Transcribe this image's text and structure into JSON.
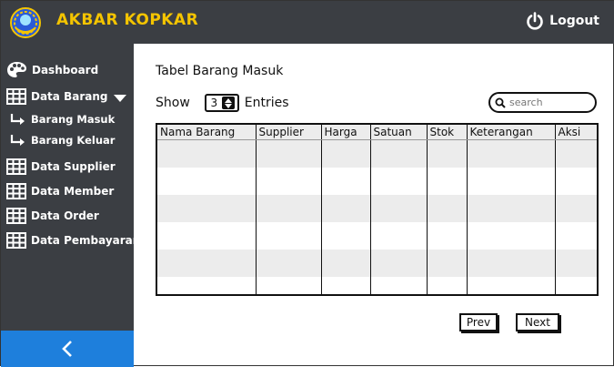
{
  "header": {
    "brand": "AKBAR KOPKAR",
    "logout_label": "Logout",
    "colors": {
      "background": "#3b3e43",
      "brand": "#f4c400"
    }
  },
  "sidebar": {
    "items": [
      {
        "label": "Dashboard",
        "icon": "palette-icon"
      },
      {
        "label": "Data Barang",
        "icon": "table-icon",
        "expanded": true
      },
      {
        "label": "Barang Masuk",
        "icon": "sub-arrow-icon"
      },
      {
        "label": "Barang Keluar",
        "icon": "sub-arrow-icon"
      },
      {
        "label": "Data Supplier",
        "icon": "table-icon"
      },
      {
        "label": "Data Member",
        "icon": "table-icon"
      },
      {
        "label": "Data Order",
        "icon": "table-icon"
      },
      {
        "label": "Data Pembayaran",
        "icon": "table-icon"
      }
    ],
    "collapse_icon": "chevron-left-icon",
    "colors": {
      "collapse_bar": "#1e7fdc"
    }
  },
  "main": {
    "title": "Tabel Barang Masuk",
    "show_label": "Show",
    "entries_value": "3",
    "entries_label": "Entries",
    "search": {
      "placeholder": "search",
      "value": ""
    },
    "table": {
      "columns": [
        "Nama Barang",
        "Supplier",
        "Harga",
        "Satuan",
        "Stok",
        "Keterangan",
        "Aksi"
      ],
      "rows": [
        [
          "",
          "",
          "",
          "",
          "",
          "",
          ""
        ],
        [
          "",
          "",
          "",
          "",
          "",
          "",
          ""
        ],
        [
          "",
          "",
          "",
          "",
          "",
          "",
          ""
        ],
        [
          "",
          "",
          "",
          "",
          "",
          "",
          ""
        ],
        [
          "",
          "",
          "",
          "",
          "",
          "",
          ""
        ],
        [
          "",
          "",
          "",
          "",
          "",
          "",
          ""
        ]
      ]
    },
    "pagination": {
      "prev_label": "Prev",
      "next_label": "Next"
    }
  }
}
